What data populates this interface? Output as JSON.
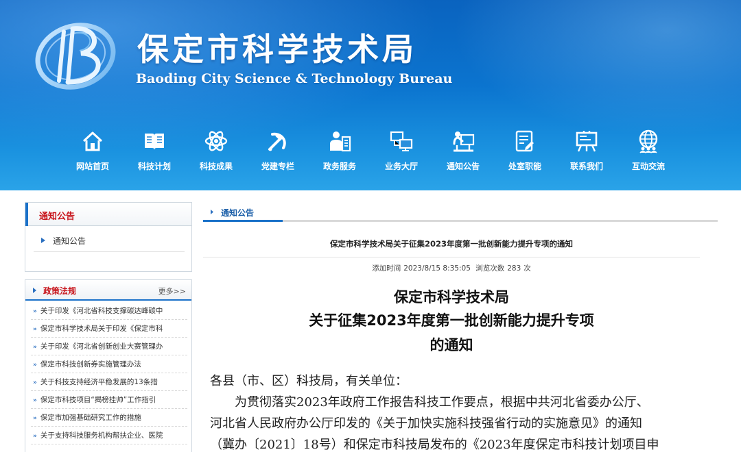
{
  "site": {
    "title": "保定市科学技术局",
    "subtitle": "Baoding City Science & Technology Bureau"
  },
  "nav": [
    {
      "label": "网站首页",
      "icon": "home-icon"
    },
    {
      "label": "科技计划",
      "icon": "book-icon"
    },
    {
      "label": "科技成果",
      "icon": "atom-icon"
    },
    {
      "label": "党建专栏",
      "icon": "hammer-sickle-icon"
    },
    {
      "label": "政务服务",
      "icon": "service-person-icon"
    },
    {
      "label": "业务大厅",
      "icon": "monitor-network-icon"
    },
    {
      "label": "通知公告",
      "icon": "announcement-icon"
    },
    {
      "label": "处室职能",
      "icon": "document-edit-icon"
    },
    {
      "label": "联系我们",
      "icon": "easel-board-icon"
    },
    {
      "label": "互动交流",
      "icon": "globe-people-icon"
    }
  ],
  "sidebar": {
    "notice_box": {
      "title": "通知公告",
      "items": [
        "通知公告"
      ]
    },
    "policy_box": {
      "title": "政策法规",
      "more": "更多>>",
      "items": [
        "关于印发《河北省科技支撑碳达峰碳中",
        "保定市科学技术局关于印发《保定市科",
        "关于印发《河北省创新创业大赛管理办",
        "保定市科技创新券实施管理办法",
        "关于科技支持经济平稳发展的13条措",
        "保定市科技项目“揭榜挂帅”工作指引",
        "保定市加强基础研究工作的措施",
        "关于支持科技服务机构帮扶企业、医院"
      ]
    }
  },
  "breadcrumb": {
    "label": "通知公告"
  },
  "article": {
    "title": "保定市科学技术局关于征集2023年度第一批创新能力提升专项的通知",
    "meta": {
      "added_label": "添加时间",
      "added_time": "2023/8/15 8:35:05",
      "views_label": "浏览次数",
      "views": "283",
      "views_unit": "次"
    },
    "doc_heading": [
      "保定市科学技术局",
      "关于征集2023年度第一批创新能力提升专项",
      "的通知"
    ],
    "body_lines": [
      "各县（市、区）科技局，有关单位：",
      "　　为贯彻落实2023年政府工作报告科技工作要点，根据中共河北省委办公厅、",
      "河北省人民政府办公厅印发的《关于加快实施科技强省行动的实施意见》的通知",
      "（冀办〔2021〕18号）和保定市科技局发布的《2023年度保定市科技计划项目申"
    ]
  }
}
